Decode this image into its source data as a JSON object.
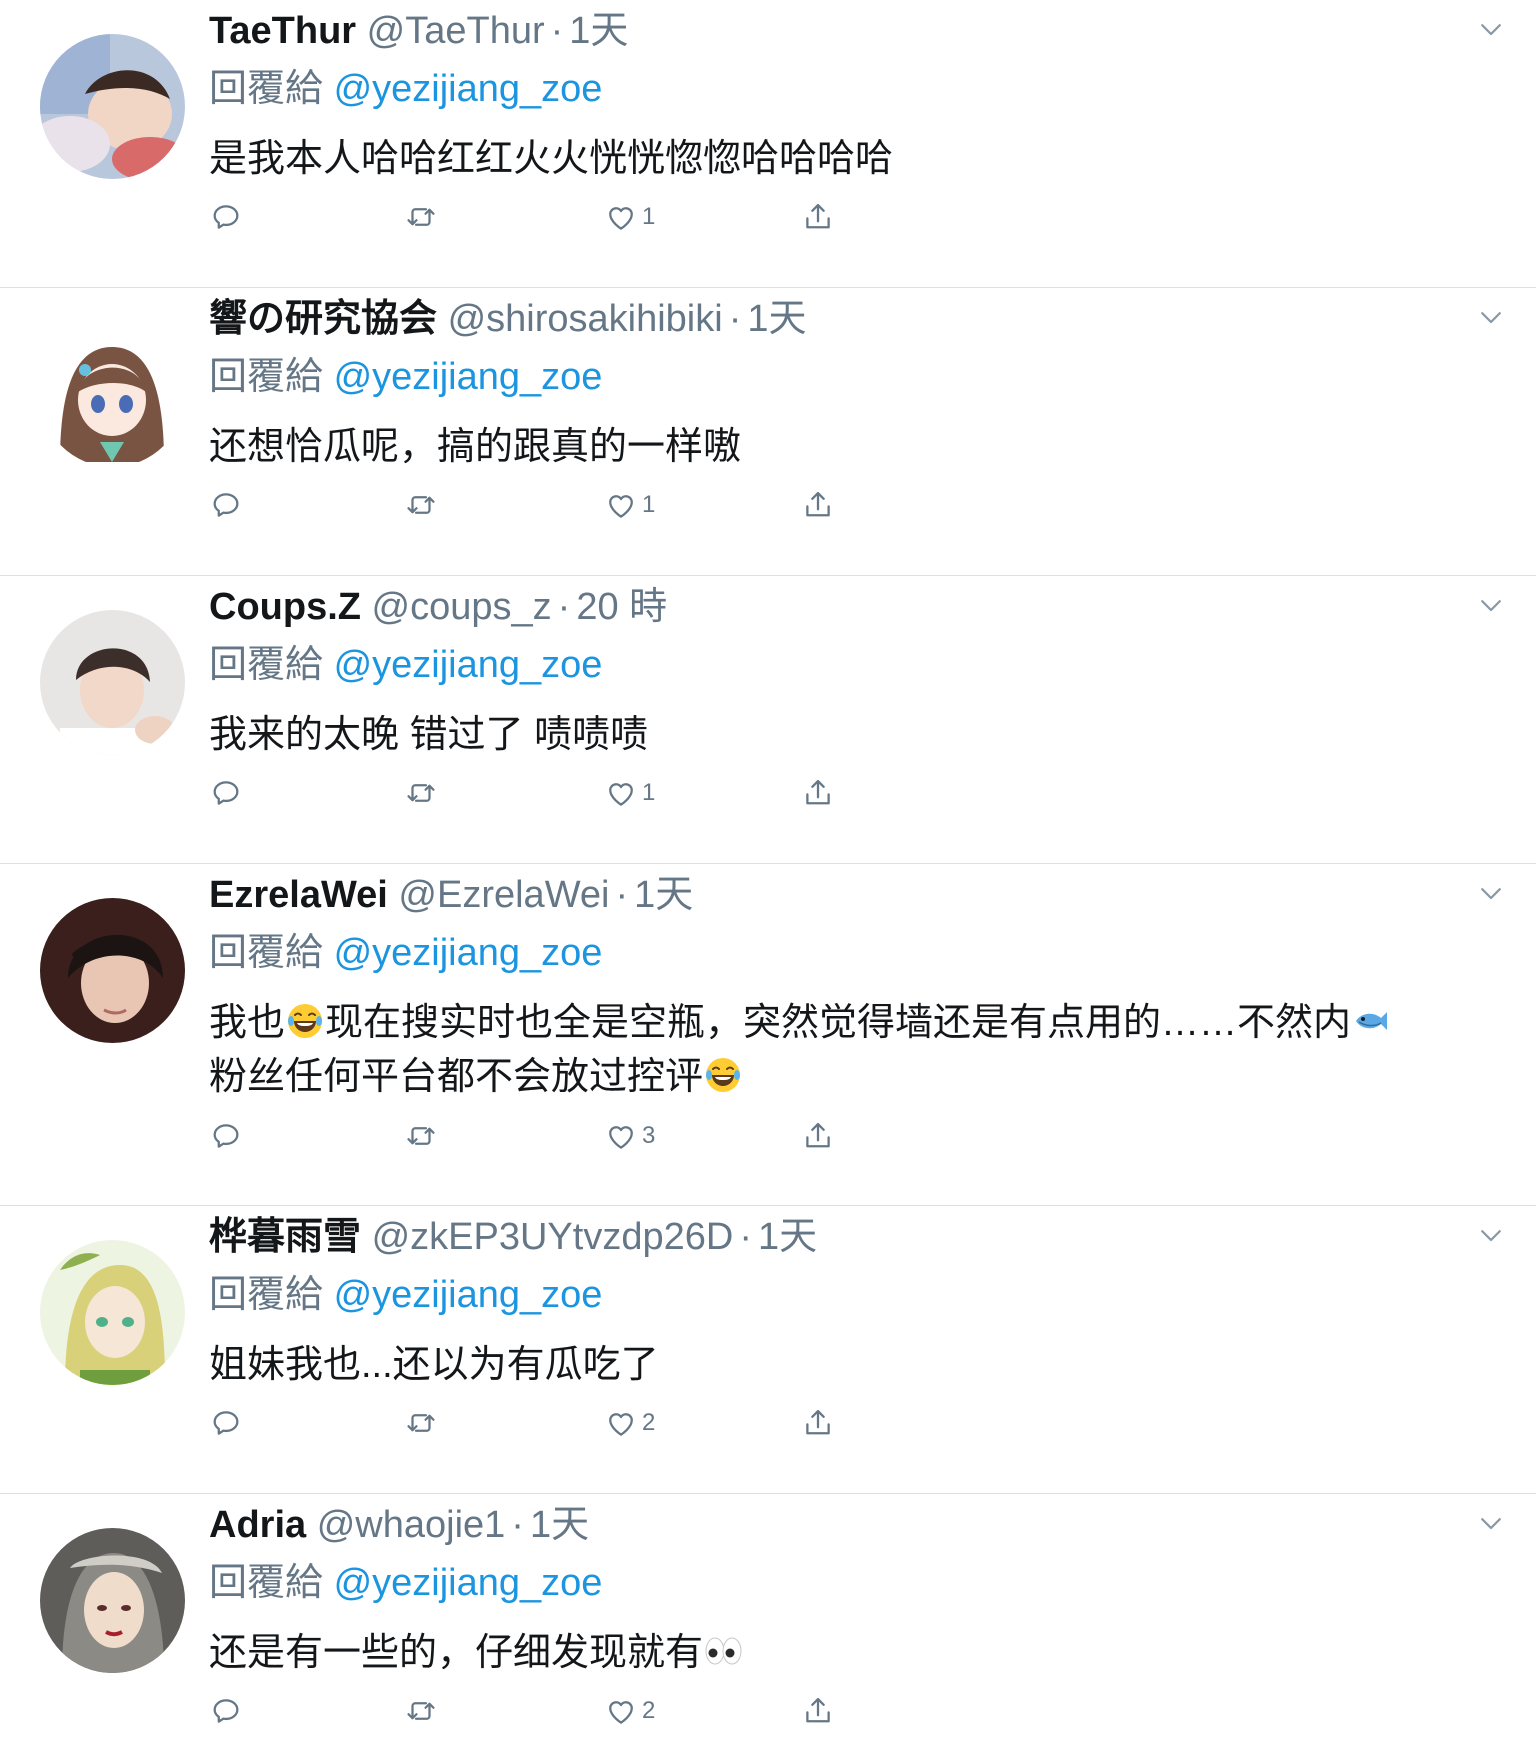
{
  "reply_prefix": "回覆給",
  "tweets": [
    {
      "name": "TaeThur",
      "handle": "@TaeThur",
      "time": "1天",
      "reply_to": "@yezijiang_zoe",
      "text": "是我本人哈哈红红火火恍恍惚惚哈哈哈哈",
      "likes": "1"
    },
    {
      "name": "響の研究協会",
      "handle": "@shirosakihibiki",
      "time": "1天",
      "reply_to": "@yezijiang_zoe",
      "text": "还想恰瓜呢，搞的跟真的一样嗷",
      "likes": "1"
    },
    {
      "name": "Coups.Z",
      "handle": "@coups_z",
      "time": "20 時",
      "reply_to": "@yezijiang_zoe",
      "text": "我来的太晚 错过了 啧啧啧",
      "likes": "1"
    },
    {
      "name": "EzrelaWei",
      "handle": "@EzrelaWei",
      "time": "1天",
      "reply_to": "@yezijiang_zoe",
      "text_a": "我也",
      "text_b": "现在搜实时也全是空瓶，突然觉得墙还是有点用的……不然内",
      "text_c": "粉丝任何平台都不会放过控评",
      "emoji_1": "laughing-tears-emoji",
      "emoji_2": "fish-emoji",
      "emoji_3": "laughing-tears-emoji",
      "likes": "3"
    },
    {
      "name": "桦暮雨雪",
      "handle": "@zkEP3UYtvzdp26D",
      "time": "1天",
      "reply_to": "@yezijiang_zoe",
      "text": "姐妹我也...还以为有瓜吃了",
      "likes": "2"
    },
    {
      "name": "Adria",
      "handle": "@whaojie1",
      "time": "1天",
      "reply_to": "@yezijiang_zoe",
      "text": "还是有一些的，仔细发现就有",
      "emoji": "eyes-emoji",
      "likes": "2"
    }
  ],
  "icons": {
    "reply": "reply-icon",
    "retweet": "retweet-icon",
    "like": "heart-icon",
    "share": "share-icon",
    "menu": "chevron-down-icon"
  },
  "colors": {
    "text": "#14171a",
    "secondary": "#657786",
    "link": "#1b95e0",
    "divider": "#dcdfe3"
  }
}
